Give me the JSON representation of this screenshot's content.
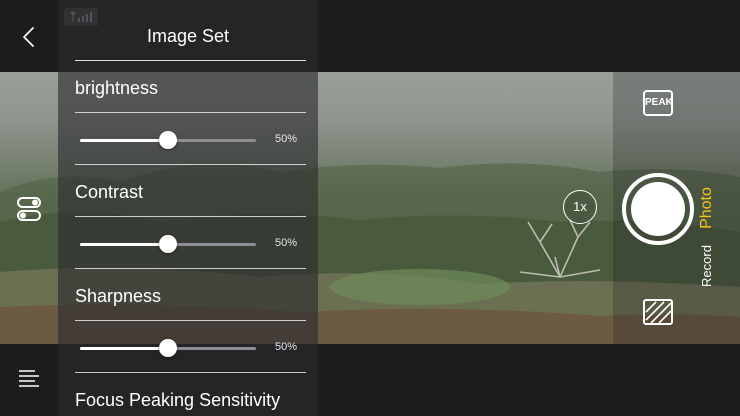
{
  "panel": {
    "title": "Image Set",
    "brightness": {
      "label": "brightness",
      "value": 0.5,
      "value_label": "50%"
    },
    "contrast": {
      "label": "Contrast",
      "value": 0.5,
      "value_label": "50%"
    },
    "sharpness": {
      "label": "Sharpness",
      "value": 0.5,
      "value_label": "50%"
    },
    "focus_peaking": {
      "label": "Focus Peaking Sensitivity"
    }
  },
  "controls": {
    "peak_label": "PEAK",
    "zoom_label": "1x",
    "mode_photo": "Photo",
    "mode_record": "Record"
  },
  "icons": {
    "back": "chevron-left-icon",
    "toggle": "toggle-settings-icon",
    "menu": "list-menu-icon",
    "signal": "signal-icon",
    "grid": "hatch-grid-icon"
  },
  "colors": {
    "accent_photo": "#f0c419",
    "panel_bg": "#2c2c2e",
    "bar_bg": "#1c1c1e"
  }
}
